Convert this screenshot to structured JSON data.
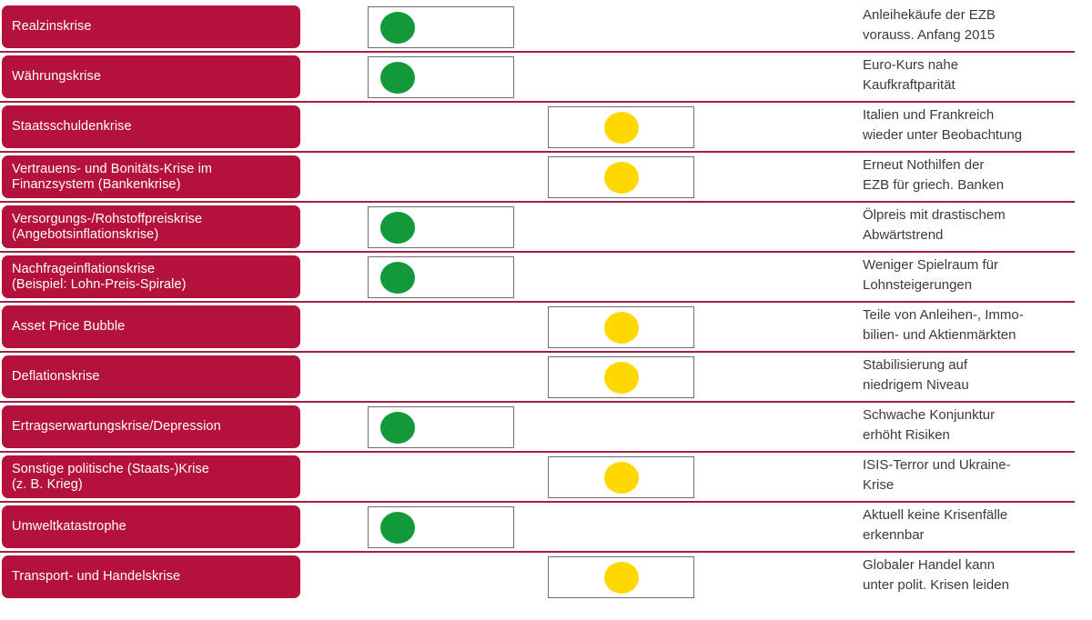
{
  "meta": {
    "colors": {
      "crisis_pill": "#b4123c",
      "separator": "#a32040",
      "light_green": "#11993a",
      "light_yellow": "#ffd800",
      "comment_text": "#3b3b3b",
      "box_border": "#6e6e6e",
      "background": "#ffffff"
    }
  },
  "legend": {
    "green_name": "green-traffic-light",
    "yellow_name": "yellow-traffic-light"
  },
  "rows": [
    {
      "crisis": "Realzinskrise",
      "status": "green",
      "comment": "Anleihekäufe der EZB\nvorauss. Anfang 2015"
    },
    {
      "crisis": "Währungskrise",
      "status": "green",
      "comment": "Euro-Kurs nahe\nKaufkraftparität"
    },
    {
      "crisis": "Staatsschuldenkrise",
      "status": "yellow",
      "comment": "Italien und Frankreich\nwieder unter Beobachtung"
    },
    {
      "crisis": "Vertrauens- und Bonitäts-Krise im\nFinanzsystem (Bankenkrise)",
      "status": "yellow",
      "comment": "Erneut Nothilfen der\nEZB für griech. Banken"
    },
    {
      "crisis": "Versorgungs-/Rohstoffpreiskrise\n(Angebotsinflationskrise)",
      "status": "green",
      "comment": "Ölpreis mit drastischem\nAbwärtstrend"
    },
    {
      "crisis": "Nachfrageinflationskrise\n(Beispiel: Lohn-Preis-Spirale)",
      "status": "green",
      "comment": "Weniger Spielraum für\nLohnsteigerungen"
    },
    {
      "crisis": "Asset Price Bubble",
      "status": "yellow",
      "comment": "Teile von Anleihen-, Immo-\nbilien- und Aktienmärkten"
    },
    {
      "crisis": "Deflationskrise",
      "status": "yellow",
      "comment": "Stabilisierung auf\nniedrigem Niveau"
    },
    {
      "crisis": "Ertragserwartungskrise/Depression",
      "status": "green",
      "comment": "Schwache Konjunktur\nerhöht Risiken"
    },
    {
      "crisis": "Sonstige politische (Staats-)Krise\n(z. B. Krieg)",
      "status": "yellow",
      "comment": "ISIS-Terror und Ukraine-\nKrise"
    },
    {
      "crisis": "Umweltkatastrophe",
      "status": "green",
      "comment": "Aktuell keine Krisenfälle\nerkennbar"
    },
    {
      "crisis": "Transport- und Handelskrise",
      "status": "yellow",
      "comment": "Globaler Handel kann\nunter polit. Krisen leiden"
    }
  ]
}
